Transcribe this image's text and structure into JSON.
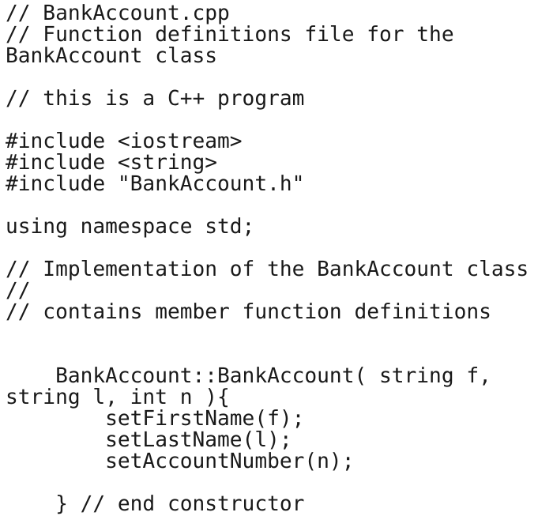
{
  "document": {
    "kind": "source-code-listing",
    "language": "C++",
    "file_name": "BankAccount.cpp",
    "background_color": "#ffffff",
    "text_color": "#191919"
  },
  "code": {
    "lines": [
      "// BankAccount.cpp",
      "// Function definitions file for the",
      "BankAccount class",
      "",
      "// this is a C++ program",
      "",
      "#include <iostream>",
      "#include <string>",
      "#include \"BankAccount.h\"",
      "",
      "using namespace std;",
      "",
      "// Implementation of the BankAccount class",
      "//",
      "// contains member function definitions",
      "",
      "",
      "    BankAccount::BankAccount( string f,",
      "string l, int n ){",
      "        setFirstName(f);",
      "        setLastName(l);",
      "        setAccountNumber(n);",
      "",
      "    } // end constructor"
    ]
  }
}
